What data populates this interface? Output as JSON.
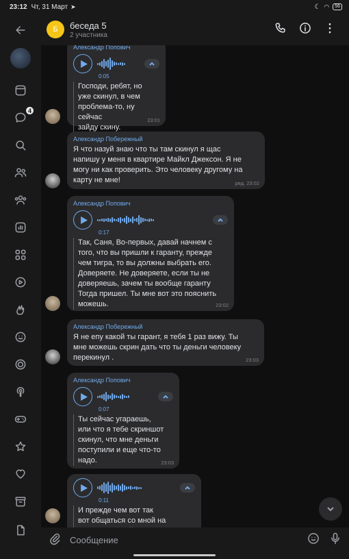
{
  "status": {
    "time": "23:12",
    "date": "Чт, 31 Март",
    "battery": "56"
  },
  "header": {
    "avatar_letter": "Б",
    "title": "беседа 5",
    "subtitle": "2 участника"
  },
  "sidebar": {
    "badge_count": "4"
  },
  "messages": [
    {
      "author": "Александр Попович",
      "type": "voice",
      "duration": "0:05",
      "transcript": "Господи, ребят, но\nуже скинул, в чем\nпроблема-то, ну сейчас\nзайду скину.",
      "time": "23:01"
    },
    {
      "author": "Александр Побережный",
      "type": "text",
      "text": "Я что назуй знаю что ты там скинул я щас\nнапишу у меня в квартире Майкл Джексон. Я не\nмогу ни как проверить. Это человеку другому на\nкарту не мне!",
      "time": "ред. 23:02"
    },
    {
      "author": "Александр Попович",
      "type": "voice",
      "duration": "0:17",
      "transcript": "Так, Саня, Во-первых, давай начнем с\nтого, что вы пришли к гаранту, прежде\nчем тигра, то вы должны выбрать его.\nДоверяете. Не доверяете, если ты не\nдоверяешь, зачем ты вообще гаранту\nТогда пришел. Ты мне вот это пояснить\nможешь.",
      "time": "23:02"
    },
    {
      "author": "Александр Побережный",
      "type": "text",
      "text": "Я не епу какой ты гарант, я тебя 1 раз вижу. Ты\nмне можешь скрин дать что ты деньги человеку\nперекинул .",
      "time": "23:03"
    },
    {
      "author": "Александр Попович",
      "type": "voice",
      "duration": "0:07",
      "transcript": "Ты сейчас угараешь,\nили что я тебе скриншот\nскинул, что мне деньги\nпоступили и еще что-то\nнадо.",
      "time": "23:03"
    },
    {
      "author": "Александр Попович",
      "type": "voice",
      "duration": "0:11",
      "transcript": "И прежде чем вот так\nвот общаться со мной на\nматах, выбирай выражение",
      "time": ""
    }
  ],
  "composer": {
    "placeholder": "Сообщение"
  },
  "icons": {
    "back": "back-arrow-icon",
    "call": "phone-icon",
    "info": "info-icon",
    "more": "more-vertical-icon"
  }
}
